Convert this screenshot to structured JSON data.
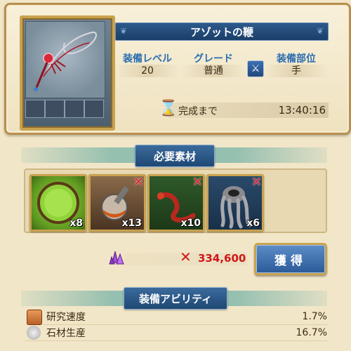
{
  "equipment": {
    "name": "アゾットの鞭",
    "level_label": "装備レベル",
    "level_value": "20",
    "grade_label": "グレード",
    "grade_value": "普通",
    "slot_label": "装備部位",
    "slot_value": "手",
    "slot_icon": "sword-icon",
    "timer_label": "完成まで",
    "timer_value": "13:40:16"
  },
  "materials": {
    "title": "必要素材",
    "items": [
      {
        "icon": "green-orb-icon",
        "count": "x8",
        "missing": false
      },
      {
        "icon": "alchemy-flask-icon",
        "count": "x13",
        "missing": true
      },
      {
        "icon": "red-serpent-icon",
        "count": "x10",
        "missing": true
      },
      {
        "icon": "grey-tentacle-icon",
        "count": "x6",
        "missing": true
      }
    ]
  },
  "cost": {
    "icon": "purple-crystal-icon",
    "value": "334,600",
    "missing_mark": "✕"
  },
  "acquire_button": "獲得",
  "abilities": {
    "title": "装備アビリティ",
    "items": [
      {
        "icon": "book-icon",
        "label": "研究速度",
        "value": "1.7%"
      },
      {
        "icon": "stone-icon",
        "label": "石材生産",
        "value": "16.7%"
      }
    ]
  },
  "colors": {
    "accent_blue": "#1f4874",
    "gold_border": "#c9a24e",
    "missing_red": "#d01818"
  }
}
